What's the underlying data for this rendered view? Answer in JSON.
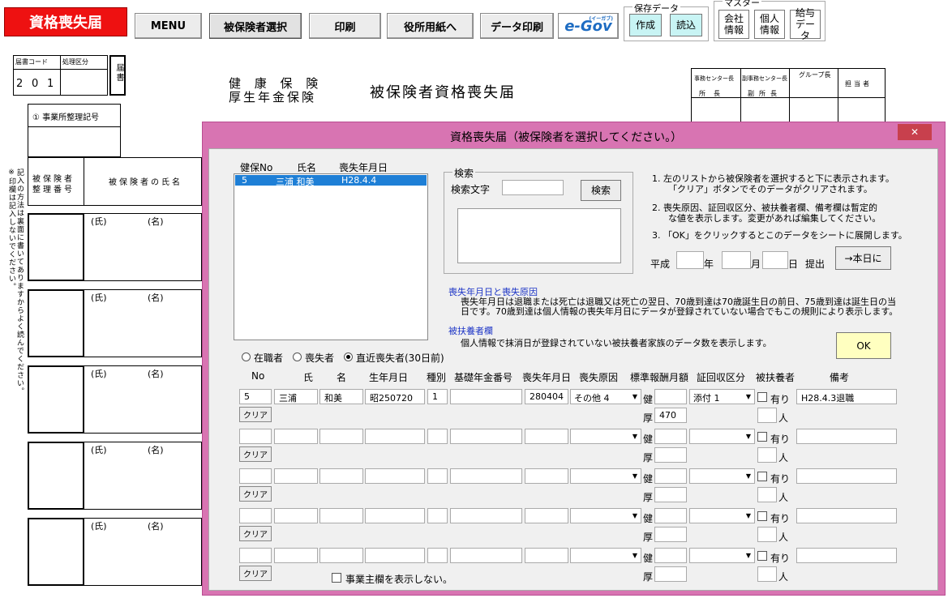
{
  "toolbar": {
    "app_title": "資格喪失届",
    "menu": "MENU",
    "select": "被保険者選択",
    "print": "印刷",
    "office_form": "役所用紙へ",
    "data_print": "データ印刷",
    "egov": "e-Gov",
    "egov_small": "(イーガブ)",
    "save_group": "保存データ",
    "create": "作成",
    "load": "読込",
    "master_group": "マスター",
    "company": "会社情報",
    "personal": "個人情報",
    "salary": "給与データ"
  },
  "form": {
    "doc_code_label": "届書コード",
    "proc_label": "処理区分",
    "todoke": "届書",
    "doc_code": [
      "2",
      "0",
      "1"
    ],
    "insurance1": "健 康 保 険",
    "insurance2": "厚生年金保険",
    "title": "被保険者資格喪失届",
    "office_no": "① 事業所整理記号",
    "note_vertical": "記入の方法は裏面に書いてありますからよく読んでください。",
    "note_vertical2": "※印欄は記入しないでください。",
    "col_no": "被保険者整理番号",
    "col_name": "被保険者の氏名",
    "shi": "(氏)",
    "mei": "(名)",
    "center_head": "事務センター長",
    "sub_center": "副事務センター長",
    "group_head": "グループ長",
    "tanto": "担当者",
    "shocho": "所長",
    "fukushocho": "副所長"
  },
  "dialog": {
    "title": "資格喪失届（被保険者を選択してください。）",
    "close": "✕",
    "list_headers": [
      "健保No",
      "氏名",
      "喪失年月日"
    ],
    "list_items": [
      {
        "no": "5",
        "name": "三浦 和美",
        "date": "H28.4.4"
      }
    ],
    "search_group": "検索",
    "search_label": "検索文字",
    "search_btn": "検索",
    "search_value": "",
    "instr1": "1. 左のリストから被保険者を選択すると下に表示されます。",
    "instr1b": "「クリア」ボタンでそのデータがクリアされます。",
    "instr2": "2. 喪失原因、証回収区分、被扶養者欄、備考欄は暫定的",
    "instr2b": "な値を表示します。変更があれば編集してください。",
    "instr3": "3. 「OK」をクリックするとこのデータをシートに展開します。",
    "heisei": "平成",
    "year": "年",
    "month": "月",
    "day": "日",
    "teishutsu": "提出",
    "today_btn": "→本日に",
    "expl1_title": "喪失年月日と喪失原因",
    "expl1": "喪失年月日は退職または死亡は退職又は死亡の翌日、70歳到達は70歳誕生日の前日、75歳到達は誕生日の当日です。70歳到達は個人情報の喪失年月日にデータが登録されていない場合でもこの規則により表示します。",
    "expl2_title": "被扶養者欄",
    "expl2": "個人情報で抹消日が登録されていない被扶養者家族のデータ数を表示します。",
    "ok": "OK",
    "radio_options": [
      "在職者",
      "喪失者",
      "直近喪失者(30日前)"
    ],
    "radio_selected": 2,
    "columns": [
      "No",
      "氏",
      "名",
      "生年月日",
      "種別",
      "基礎年金番号",
      "喪失年月日",
      "喪失原因",
      "標準報酬月額",
      "証回収区分",
      "被扶養者",
      "備考"
    ],
    "ken": "健",
    "kou": "厚",
    "ari": "有り",
    "nin": "人",
    "clear": "クリア",
    "rows": [
      {
        "no": "5",
        "shi": "三浦",
        "mei": "和美",
        "birth": "昭250720",
        "kind": "1",
        "pension": "",
        "loss_date": "280404",
        "cause": "その他 4",
        "ken": "",
        "kou": "470",
        "recovery": "添付 1",
        "dependents": "",
        "note": "H28.4.3退職"
      },
      {
        "no": "",
        "shi": "",
        "mei": "",
        "birth": "",
        "kind": "",
        "pension": "",
        "loss_date": "",
        "cause": "",
        "ken": "",
        "kou": "",
        "recovery": "",
        "dependents": "",
        "note": ""
      },
      {
        "no": "",
        "shi": "",
        "mei": "",
        "birth": "",
        "kind": "",
        "pension": "",
        "loss_date": "",
        "cause": "",
        "ken": "",
        "kou": "",
        "recovery": "",
        "dependents": "",
        "note": ""
      },
      {
        "no": "",
        "shi": "",
        "mei": "",
        "birth": "",
        "kind": "",
        "pension": "",
        "loss_date": "",
        "cause": "",
        "ken": "",
        "kou": "",
        "recovery": "",
        "dependents": "",
        "note": ""
      },
      {
        "no": "",
        "shi": "",
        "mei": "",
        "birth": "",
        "kind": "",
        "pension": "",
        "loss_date": "",
        "cause": "",
        "ken": "",
        "kou": "",
        "recovery": "",
        "dependents": "",
        "note": ""
      }
    ],
    "hide_owner": "事業主欄を表示しない。"
  }
}
